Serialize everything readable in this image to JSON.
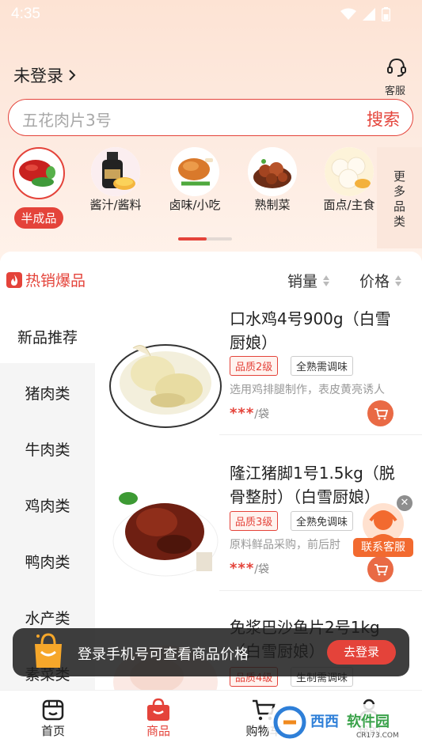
{
  "status_bar": {
    "time": "4:35"
  },
  "header": {
    "login_text": "未登录",
    "service_label": "客服"
  },
  "search": {
    "placeholder": "五花肉片3号",
    "button": "搜索"
  },
  "categories": [
    {
      "label": "半成品",
      "selected": true
    },
    {
      "label": "酱汁/酱料",
      "selected": false
    },
    {
      "label": "卤味/小吃",
      "selected": false
    },
    {
      "label": "熟制菜",
      "selected": false
    },
    {
      "label": "面点/主食",
      "selected": false
    }
  ],
  "more_categories": "更多品类",
  "hot": {
    "title": "热销爆品",
    "sort_sales": "销量",
    "sort_price": "价格"
  },
  "sidebar": [
    "新品推荐",
    "猪肉类",
    "牛肉类",
    "鸡肉类",
    "鸭肉类",
    "水产类",
    "素菜类"
  ],
  "products": [
    {
      "name": "口水鸡4号900g（白雪厨娘）",
      "quality_tag": "品质2级",
      "cook_tag": "全熟需调味",
      "desc": "选用鸡排腿制作，表皮黄亮诱人",
      "price": "***",
      "unit": "/袋"
    },
    {
      "name": "隆江猪脚1号1.5kg（脱骨整肘）（白雪厨娘）",
      "quality_tag": "品质3级",
      "cook_tag": "全熟免调味",
      "desc": "原料鲜品采购，前后肘",
      "price": "***",
      "unit": "/袋"
    },
    {
      "name": "免浆巴沙鱼片2号1kg（白雪厨娘）",
      "quality_tag": "品质4级",
      "cook_tag": "生制需调味",
      "desc": "",
      "price": "",
      "unit": ""
    }
  ],
  "float_service": {
    "label": "联系客服"
  },
  "toast": {
    "text": "登录手机号可查看商品价格",
    "button": "去登录"
  },
  "bottom_nav": [
    {
      "label": "首页",
      "icon": "home-icon",
      "active": false
    },
    {
      "label": "商品",
      "icon": "shopping-bag-icon",
      "active": true
    },
    {
      "label": "购物车",
      "icon": "cart-icon",
      "active": false
    },
    {
      "label": "我的",
      "icon": "user-icon",
      "active": false
    }
  ],
  "watermark": {
    "text": "西西软件园",
    "sub": "CR173.COM"
  },
  "colors": {
    "accent": "#e4433a",
    "cart": "#e96a45",
    "service": "#f26a2f"
  }
}
